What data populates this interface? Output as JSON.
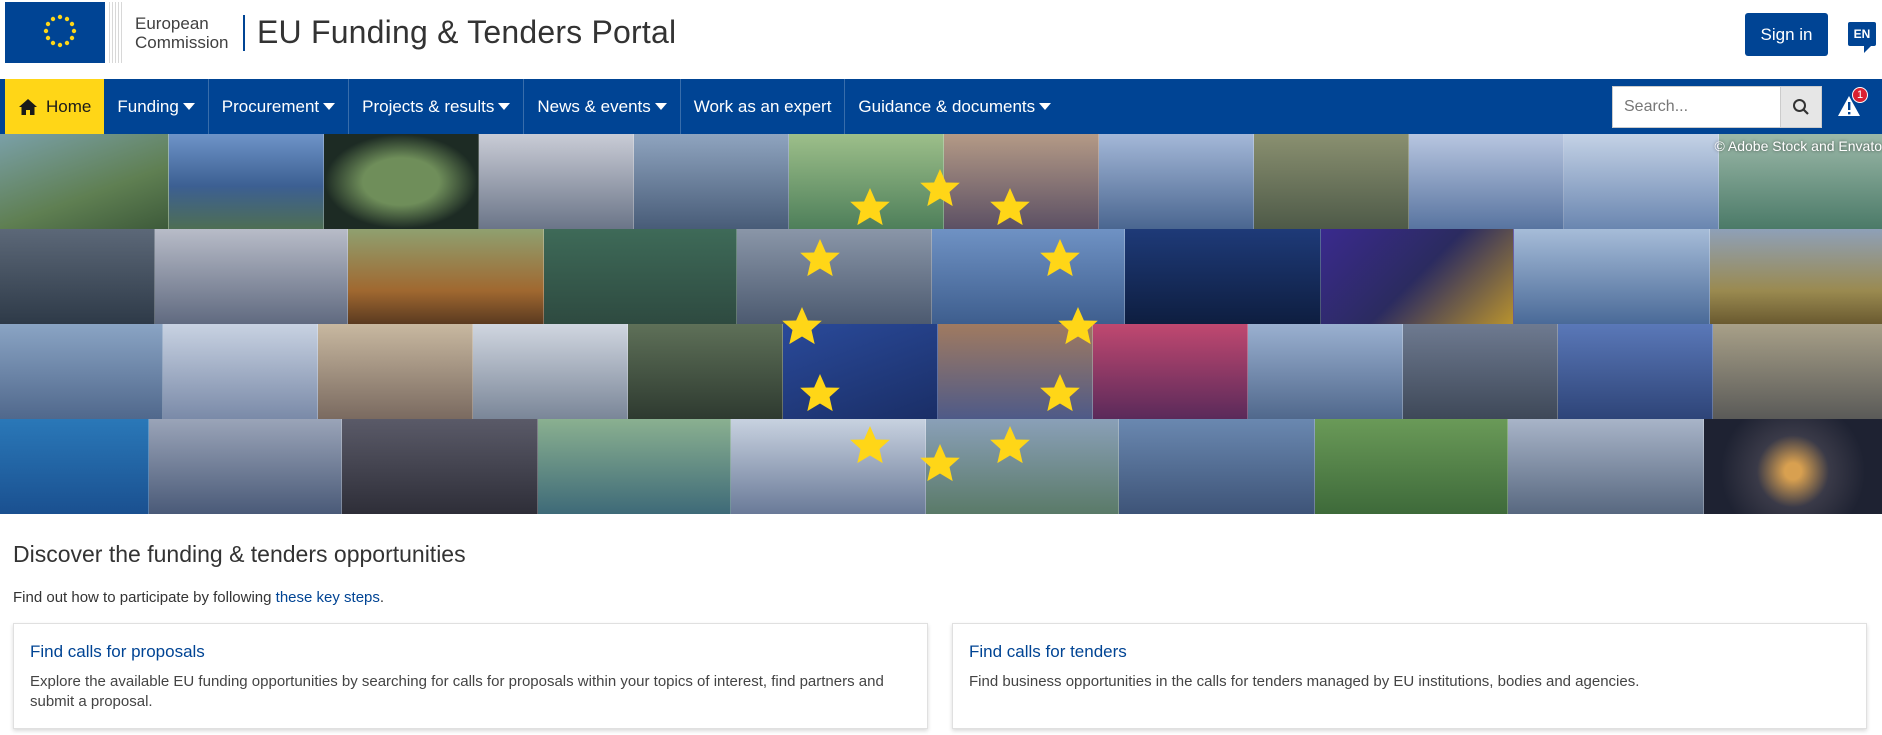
{
  "header": {
    "logo_text_line1": "European",
    "logo_text_line2": "Commission",
    "portal_title": "EU Funding & Tenders Portal",
    "signin_label": "Sign in",
    "lang_code": "EN"
  },
  "nav": {
    "items": [
      {
        "label": "Home",
        "active": true
      },
      {
        "label": "Funding",
        "dropdown": true
      },
      {
        "label": "Procurement",
        "dropdown": true
      },
      {
        "label": "Projects & results",
        "dropdown": true
      },
      {
        "label": "News & events",
        "dropdown": true
      },
      {
        "label": "Work as an expert",
        "dropdown": false
      },
      {
        "label": "Guidance & documents",
        "dropdown": true
      }
    ],
    "search_placeholder": "Search...",
    "alert_count": "1"
  },
  "banner": {
    "credit": "© Adobe Stock and Envato"
  },
  "main": {
    "heading": "Discover the funding & tenders opportunities",
    "lead_prefix": "Find out how to participate by following ",
    "lead_link": "these key steps",
    "lead_suffix": ".",
    "cards": [
      {
        "title": "Find calls for proposals",
        "text": "Explore the available EU funding opportunities by searching for calls for proposals within your topics of interest, find partners and submit a proposal."
      },
      {
        "title": "Find calls for tenders",
        "text": "Find business opportunities in the calls for tenders managed by EU institutions, bodies and agencies."
      }
    ]
  },
  "colors": {
    "brand_blue": "#004494",
    "highlight_yellow": "#ffd617",
    "alert_red": "#da2131"
  }
}
